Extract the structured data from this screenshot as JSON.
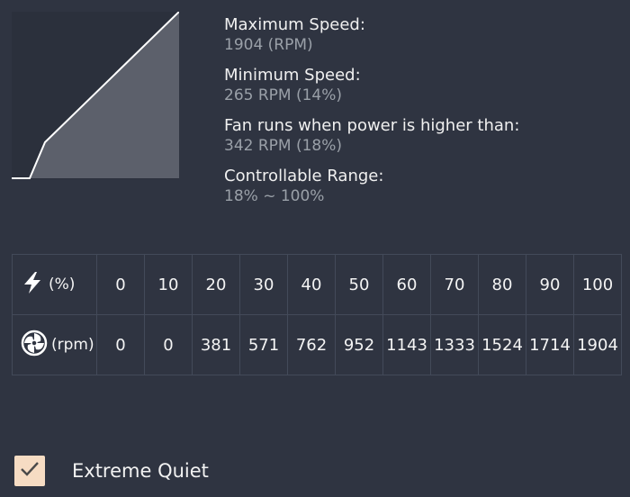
{
  "info": [
    {
      "label": "Maximum Speed:",
      "value": "1904 (RPM)"
    },
    {
      "label": "Minimum Speed:",
      "value": "265 RPM (14%)"
    },
    {
      "label": "Fan runs when power is higher than:",
      "value": "342 RPM (18%)"
    },
    {
      "label": "Controllable Range:",
      "value": "18% ~ 100%"
    }
  ],
  "table": {
    "power_unit": "(%)",
    "rpm_unit": "(rpm)",
    "power": [
      "0",
      "10",
      "20",
      "30",
      "40",
      "50",
      "60",
      "70",
      "80",
      "90",
      "100"
    ],
    "rpm": [
      "0",
      "0",
      "381",
      "571",
      "762",
      "952",
      "1143",
      "1333",
      "1524",
      "1714",
      "1904"
    ]
  },
  "option": {
    "label": "Extreme Quiet",
    "checked": true
  },
  "icons": {
    "power": "lightning-bolt-icon",
    "fan": "fan-icon",
    "check": "checkmark-icon"
  },
  "colors": {
    "background": "#2f3441",
    "curve_fill": "#5c606b",
    "curve_line": "#ffffff",
    "value_text": "#9aa0a8",
    "checkbox_fill": "#f6dcc3",
    "grid": "#434a59"
  }
}
